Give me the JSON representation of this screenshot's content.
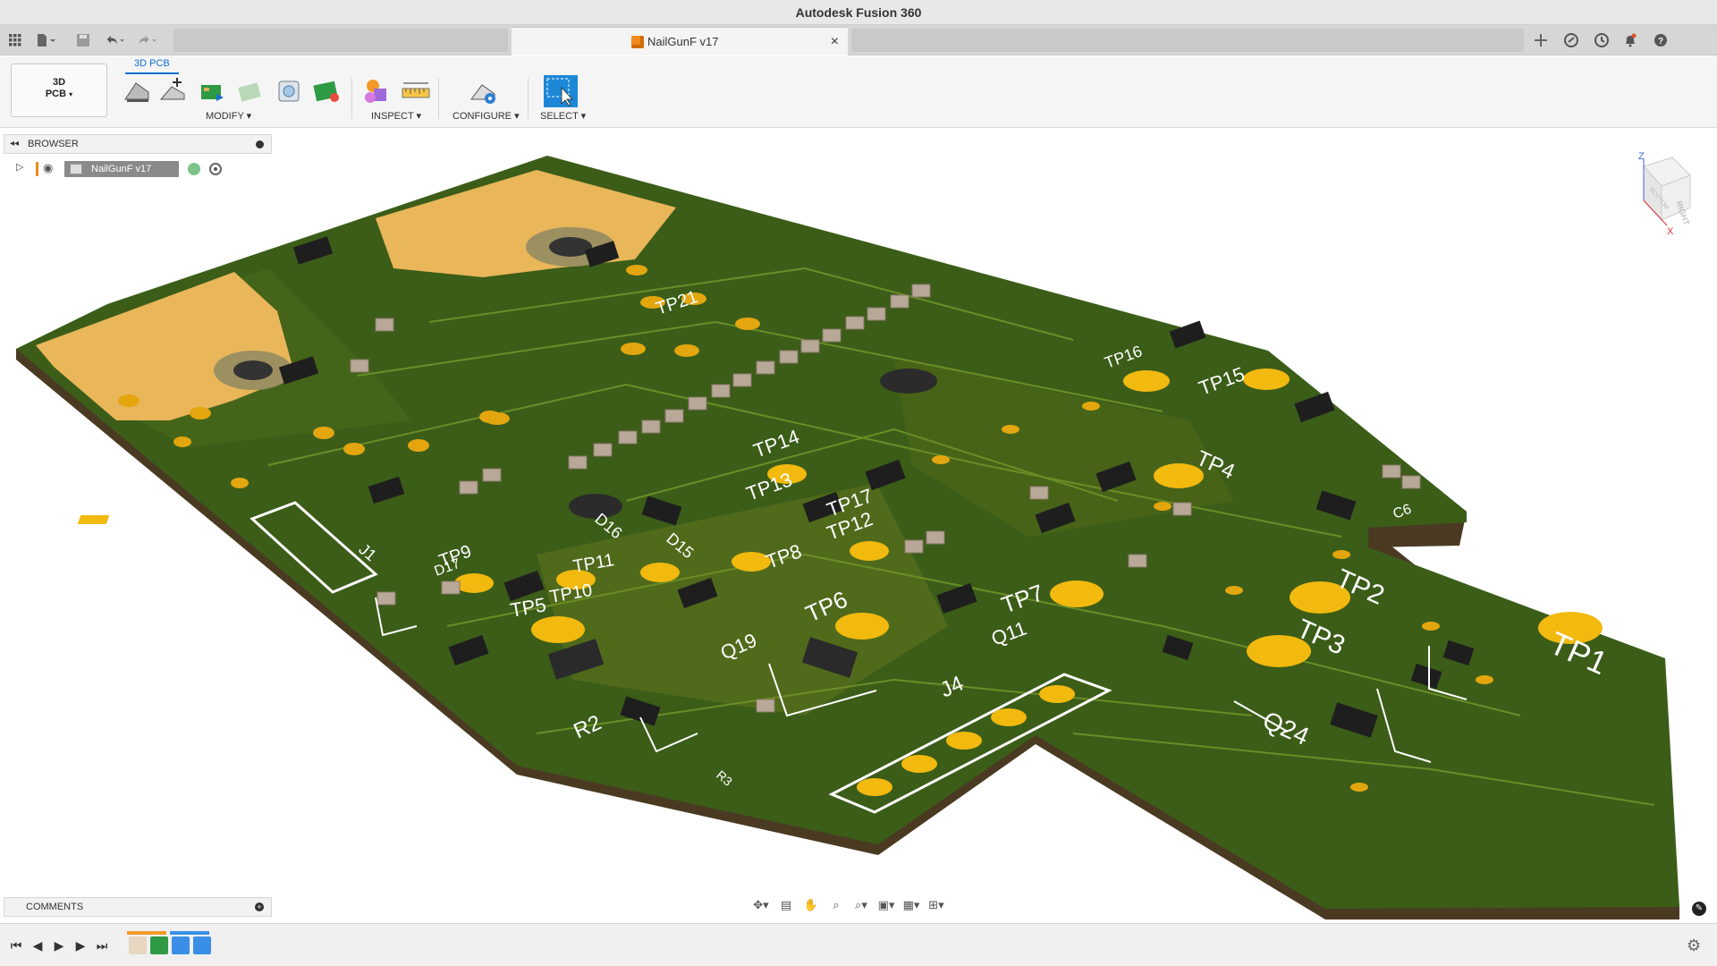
{
  "window": {
    "title": "Autodesk Fusion 360"
  },
  "tabs": {
    "doc_name": "NailGunF v17",
    "close_glyph": "×"
  },
  "quick_access": {
    "icons": [
      "apps-grid-icon",
      "file-menu-icon",
      "save-icon",
      "undo-icon",
      "redo-icon"
    ],
    "right_icons": [
      "new-tab-icon",
      "extensions-icon",
      "job-status-icon",
      "notifications-icon",
      "help-icon"
    ]
  },
  "ribbon": {
    "workspace_line1": "3D",
    "workspace_line2": "PCB",
    "active_tab": "3D PCB",
    "groups": [
      {
        "label": "MODIFY",
        "arrow": "▾"
      },
      {
        "label": "INSPECT",
        "arrow": "▾"
      },
      {
        "label": "CONFIGURE",
        "arrow": "▾"
      },
      {
        "label": "SELECT",
        "arrow": "▾"
      }
    ]
  },
  "browser": {
    "title": "BROWSER",
    "root_node": "NailGunF v17"
  },
  "comments": {
    "title": "COMMENTS"
  },
  "viewcube": {
    "face_right": "RIGHT",
    "face_bottom": "BOTTOM",
    "axis_z": "Z",
    "axis_x": "X"
  },
  "board": {
    "labels": [
      "TP1",
      "TP2",
      "TP3",
      "TP4",
      "TP5",
      "TP6",
      "TP7",
      "TP8",
      "TP9",
      "TP10",
      "TP11",
      "TP12",
      "TP13",
      "TP14",
      "TP15",
      "TP16",
      "TP17",
      "TP21",
      "Q11",
      "Q19",
      "Q24",
      "J1",
      "J4",
      "D15",
      "D16",
      "D17",
      "R2",
      "R3",
      "C6"
    ],
    "colors": {
      "board": "#3a5a16",
      "board_edge": "#4e3b1e",
      "pads": "#f2b90f",
      "copper_fill": "#e8b55a",
      "silkscreen": "#ffffff"
    }
  },
  "navbar": {
    "icons": [
      "orbit-icon",
      "look-at-icon",
      "pan-icon",
      "zoom-icon",
      "zoom-window-icon",
      "display-settings-icon",
      "grid-settings-icon",
      "viewports-icon"
    ]
  },
  "timeline": {
    "controls": [
      "first-icon",
      "previous-icon",
      "play-icon",
      "next-icon",
      "last-icon"
    ],
    "steps": 4
  }
}
